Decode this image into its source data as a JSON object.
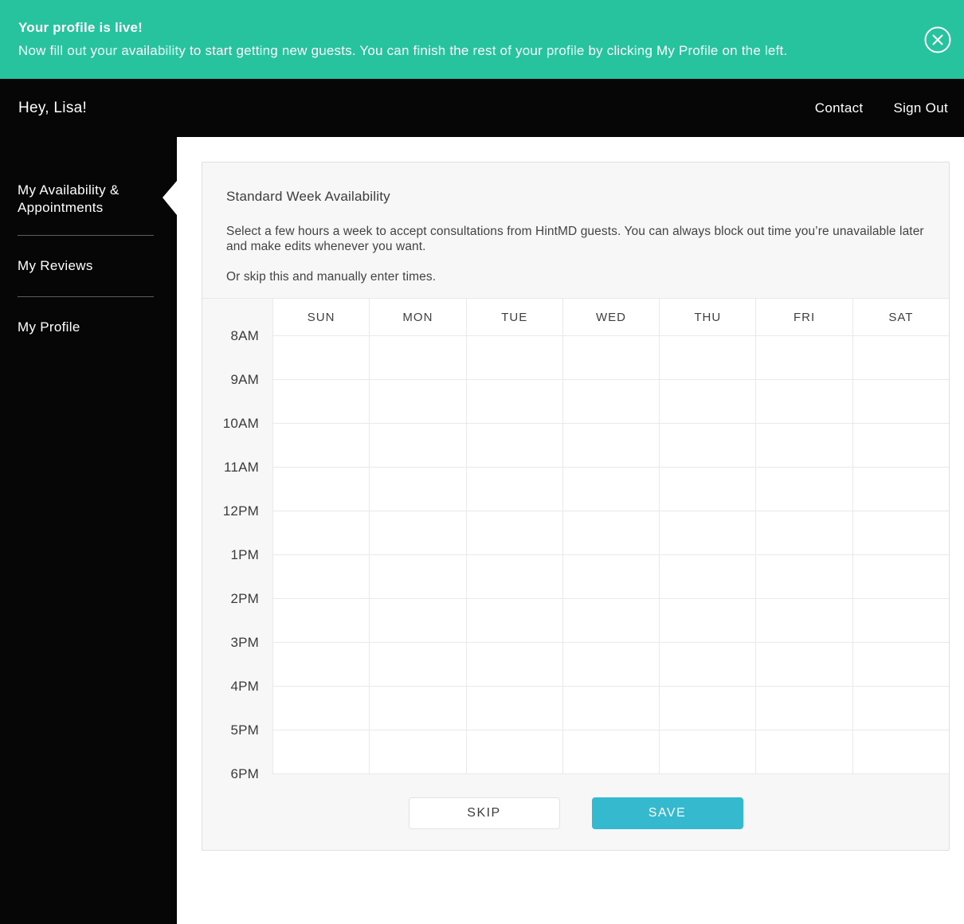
{
  "banner": {
    "title": "Your profile is live!",
    "message": "Now fill out your availability to start getting new guests. You can finish the rest of your profile by clicking My Profile on the left.",
    "background_color": "#27c29e",
    "close_icon": "circle-x"
  },
  "header": {
    "greeting": "Hey, Lisa!",
    "links": [
      {
        "label": "Contact"
      },
      {
        "label": "Sign Out"
      }
    ],
    "background_color": "#060606"
  },
  "sidebar": {
    "items": [
      {
        "label": "My Availability & Appointments",
        "active": true
      },
      {
        "label": "My Reviews",
        "active": false
      },
      {
        "label": "My Profile",
        "active": false
      }
    ]
  },
  "card": {
    "title": "Standard Week Availability",
    "description": "Select a few hours a week to accept consultations from HintMD guests. You can always block out time you’re unavailable later and make edits whenever you want.",
    "description2": "Or skip this and manually enter times.",
    "schedule": {
      "days": [
        "SUN",
        "MON",
        "TUE",
        "WED",
        "THU",
        "FRI",
        "SAT"
      ],
      "hours": [
        "8AM",
        "9AM",
        "10AM",
        "11AM",
        "12PM",
        "1PM",
        "2PM",
        "3PM",
        "4PM",
        "5PM",
        "6PM"
      ],
      "selected": []
    },
    "buttons": {
      "skip": "SKIP",
      "save": "SAVE"
    },
    "save_color": "#35b9ce"
  }
}
